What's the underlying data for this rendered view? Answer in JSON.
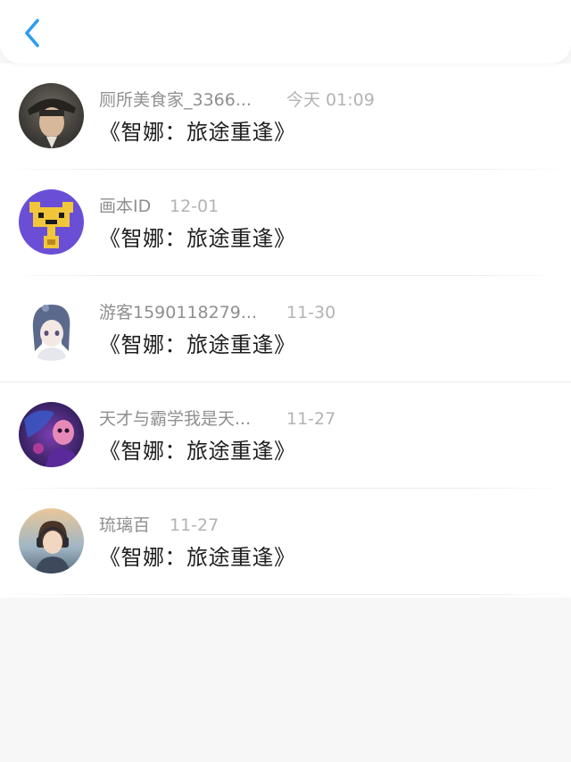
{
  "header": {
    "back_icon": "chevron-left-icon",
    "accent_color": "#2a9df4"
  },
  "comments": [
    {
      "name": "厕所美食家_3366...",
      "time": "今天 01:09",
      "content": "《智娜：旅途重逢》",
      "avatar": "man-flat-cap-avatar"
    },
    {
      "name": "画本ID",
      "time": "12-01",
      "content": "《智娜：旅途重逢》",
      "avatar": "pixel-creature-avatar"
    },
    {
      "name": "游客1590118279...",
      "time": "11-30",
      "content": "《智娜：旅途重逢》",
      "avatar": "anime-girl-avatar"
    },
    {
      "name": "天才与霸学我是天...",
      "time": "11-27",
      "content": "《智娜：旅途重逢》",
      "avatar": "purple-character-avatar"
    },
    {
      "name": "琉璃百",
      "time": "11-27",
      "content": "《智娜：旅途重逢》",
      "avatar": "anime-headphones-avatar"
    }
  ]
}
